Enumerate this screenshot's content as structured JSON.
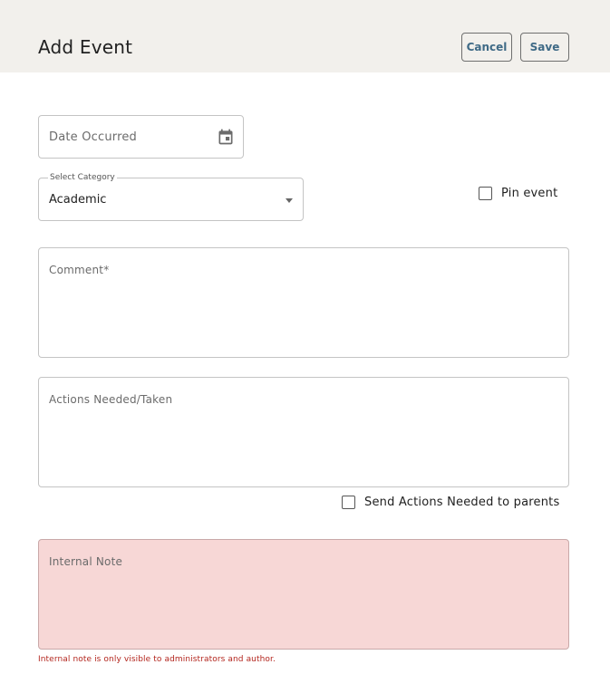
{
  "header": {
    "title": "Add Event",
    "cancel_label": "Cancel",
    "save_label": "Save"
  },
  "form": {
    "date_occurred": {
      "placeholder": "Date Occurred",
      "icon": "calendar-icon"
    },
    "category": {
      "legend": "Select Category",
      "selected": "Academic"
    },
    "pin_event": {
      "label": "Pin event",
      "checked": false
    },
    "comment": {
      "label": "Comment*"
    },
    "actions": {
      "label": "Actions Needed/Taken"
    },
    "send_to_parents": {
      "label": "Send Actions Needed to parents",
      "checked": false
    },
    "internal_note": {
      "label": "Internal Note",
      "helper": "Internal note is only visible to administrators and author."
    }
  },
  "colors": {
    "header_bg": "#f2f0ec",
    "button_text": "#3f6a86",
    "internal_note_bg": "#f7d7d6",
    "helper_text": "#b3261e"
  }
}
